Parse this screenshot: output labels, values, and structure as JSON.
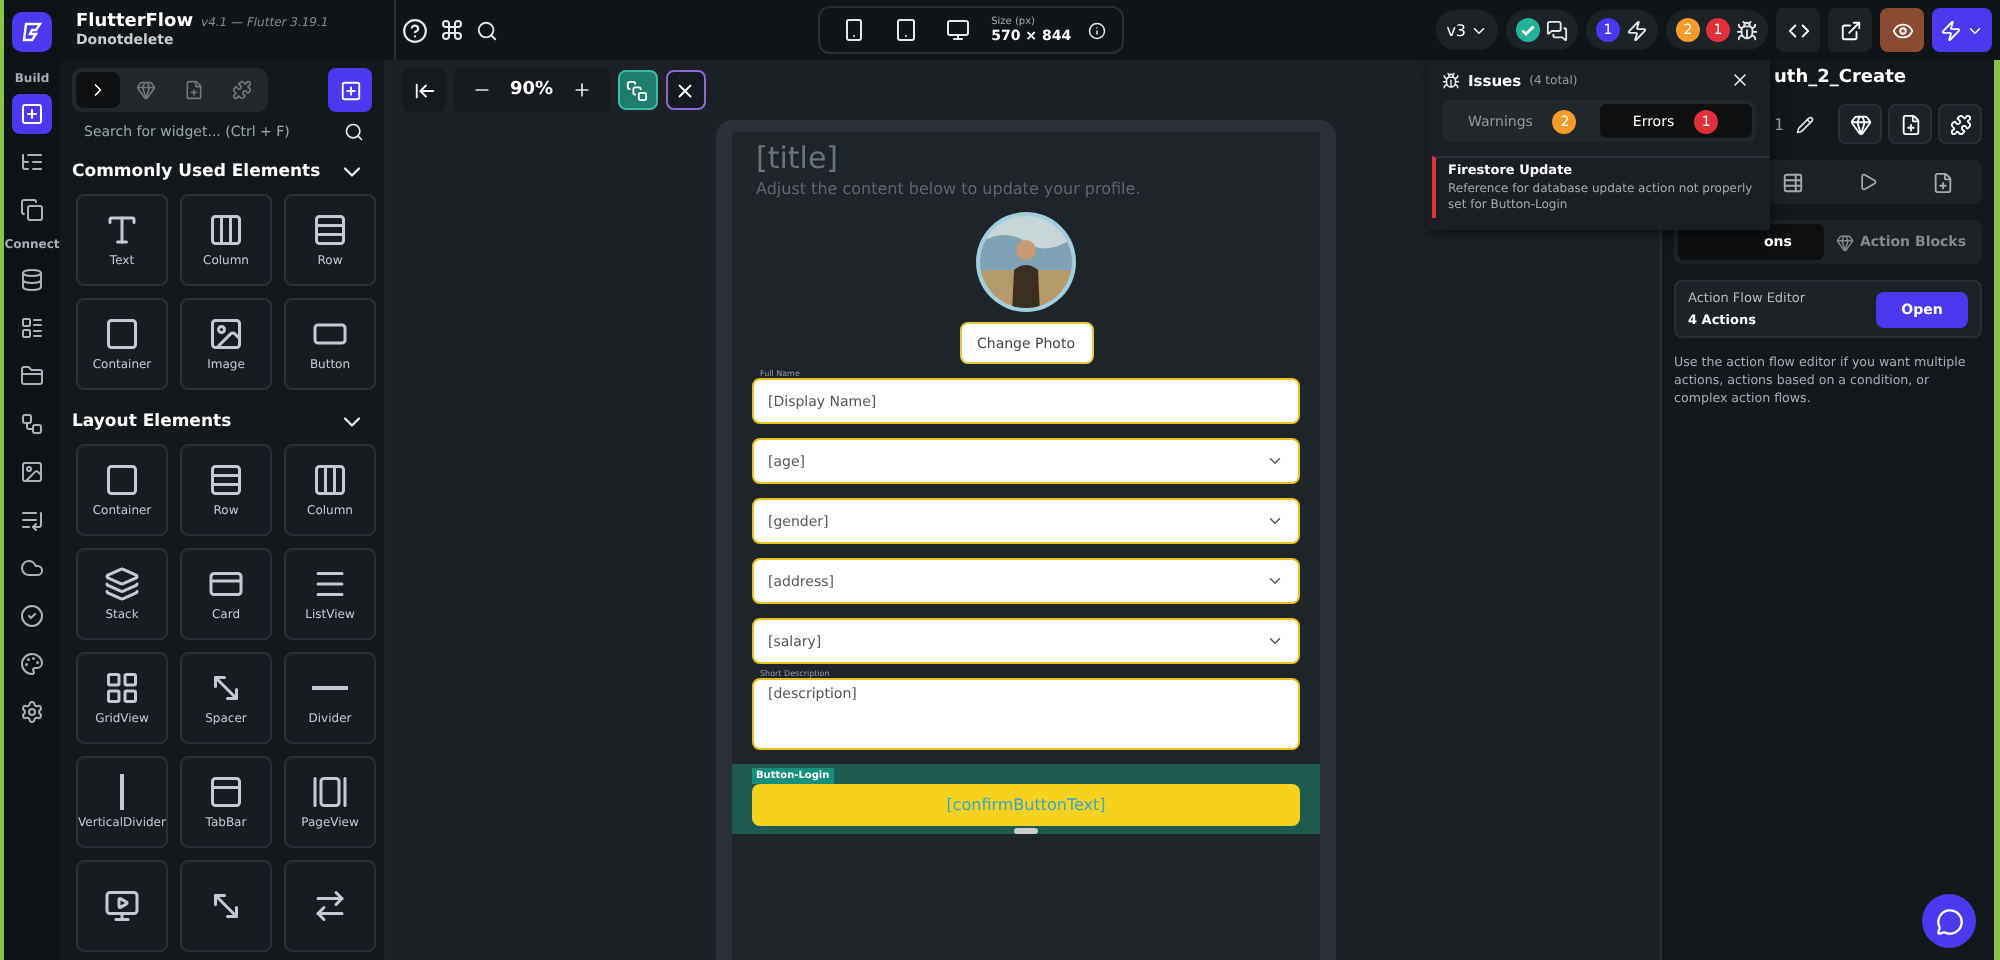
{
  "app": {
    "name": "FlutterFlow",
    "version": "v4.1 — Flutter 3.19.1",
    "project": "Donotdelete"
  },
  "rail": {
    "sections": [
      {
        "label": "Build",
        "items": [
          {
            "selected": true
          },
          {
            "selected": false
          },
          {
            "selected": false
          }
        ]
      },
      {
        "label": "Connect",
        "items": [
          {
            "selected": false
          },
          {
            "selected": false
          },
          {
            "selected": false
          },
          {
            "selected": false
          },
          {
            "selected": false
          },
          {
            "selected": false
          },
          {
            "selected": false
          },
          {
            "selected": false
          },
          {
            "selected": false
          },
          {
            "selected": false
          }
        ]
      }
    ]
  },
  "toolbar": {
    "device": {
      "size_label": "Size (px)",
      "size": "570 × 844"
    },
    "version": "v3",
    "badges": [
      {
        "text": "1",
        "color": "#4b39ef"
      },
      {
        "text": "2",
        "color": "#f39c2b"
      },
      {
        "text": "1",
        "color": "#e0303a"
      }
    ]
  },
  "left_panel": {
    "tabs": [
      {
        "selected": true
      },
      {
        "selected": false
      },
      {
        "selected": false
      },
      {
        "selected": false
      }
    ],
    "search": {
      "placeholder": "Search for widget... (Ctrl + F)"
    },
    "sections": [
      {
        "title": "Commonly Used Elements",
        "expanded": true,
        "items": [
          {
            "label": "Text"
          },
          {
            "label": "Column"
          },
          {
            "label": "Row"
          },
          {
            "label": "Container"
          },
          {
            "label": "Image"
          },
          {
            "label": "Button"
          }
        ]
      },
      {
        "title": "Layout Elements",
        "expanded": true,
        "items": [
          {
            "label": "Container"
          },
          {
            "label": "Row"
          },
          {
            "label": "Column"
          },
          {
            "label": "Stack"
          },
          {
            "label": "Card"
          },
          {
            "label": "ListView"
          },
          {
            "label": "GridView"
          },
          {
            "label": "Spacer"
          },
          {
            "label": "Divider"
          },
          {
            "label": "VerticalDivider"
          },
          {
            "label": "TabBar"
          },
          {
            "label": "PageView"
          }
        ],
        "cut_off_row": true
      }
    ]
  },
  "canvas": {
    "zoom": "90%",
    "page": {
      "title": "[title]",
      "subtitle": "Adjust the content below to update your profile.",
      "change_photo": "Change Photo",
      "fields": [
        {
          "kind": "text",
          "label": "Full Name",
          "value": "[Display Name]"
        },
        {
          "kind": "dropdown",
          "value": "[age]"
        },
        {
          "kind": "dropdown",
          "value": "[gender]"
        },
        {
          "kind": "dropdown",
          "value": "[address]"
        },
        {
          "kind": "dropdown",
          "value": "[salary]"
        },
        {
          "kind": "textarea",
          "label": "Short Description",
          "value": "[description]"
        }
      ],
      "button": {
        "tag": "Button-Login",
        "text": "[confirmButtonText]",
        "selected": true
      }
    }
  },
  "issues": {
    "title": "Issues",
    "count": "(4 total)",
    "tabs": [
      {
        "label": "Warnings",
        "badge": "2",
        "color": "#f39c2b",
        "selected": false
      },
      {
        "label": "Errors",
        "badge": "1",
        "color": "#e0303a",
        "selected": true
      }
    ],
    "items": [
      {
        "title": "Firestore Update",
        "description": "Reference for database update action not properly set for Button-Login"
      }
    ]
  },
  "right_panel": {
    "title": "uth_2_Create",
    "count": "1",
    "tabs": [
      {
        "label": "ons",
        "selected": true
      },
      {
        "label": "Action Blocks",
        "selected": false
      }
    ],
    "flow": {
      "title": "Action Flow Editor",
      "count": "4 Actions",
      "button": "Open"
    },
    "help": "Use the action flow editor if you want multiple actions, actions based on a condition, or complex action flows."
  }
}
